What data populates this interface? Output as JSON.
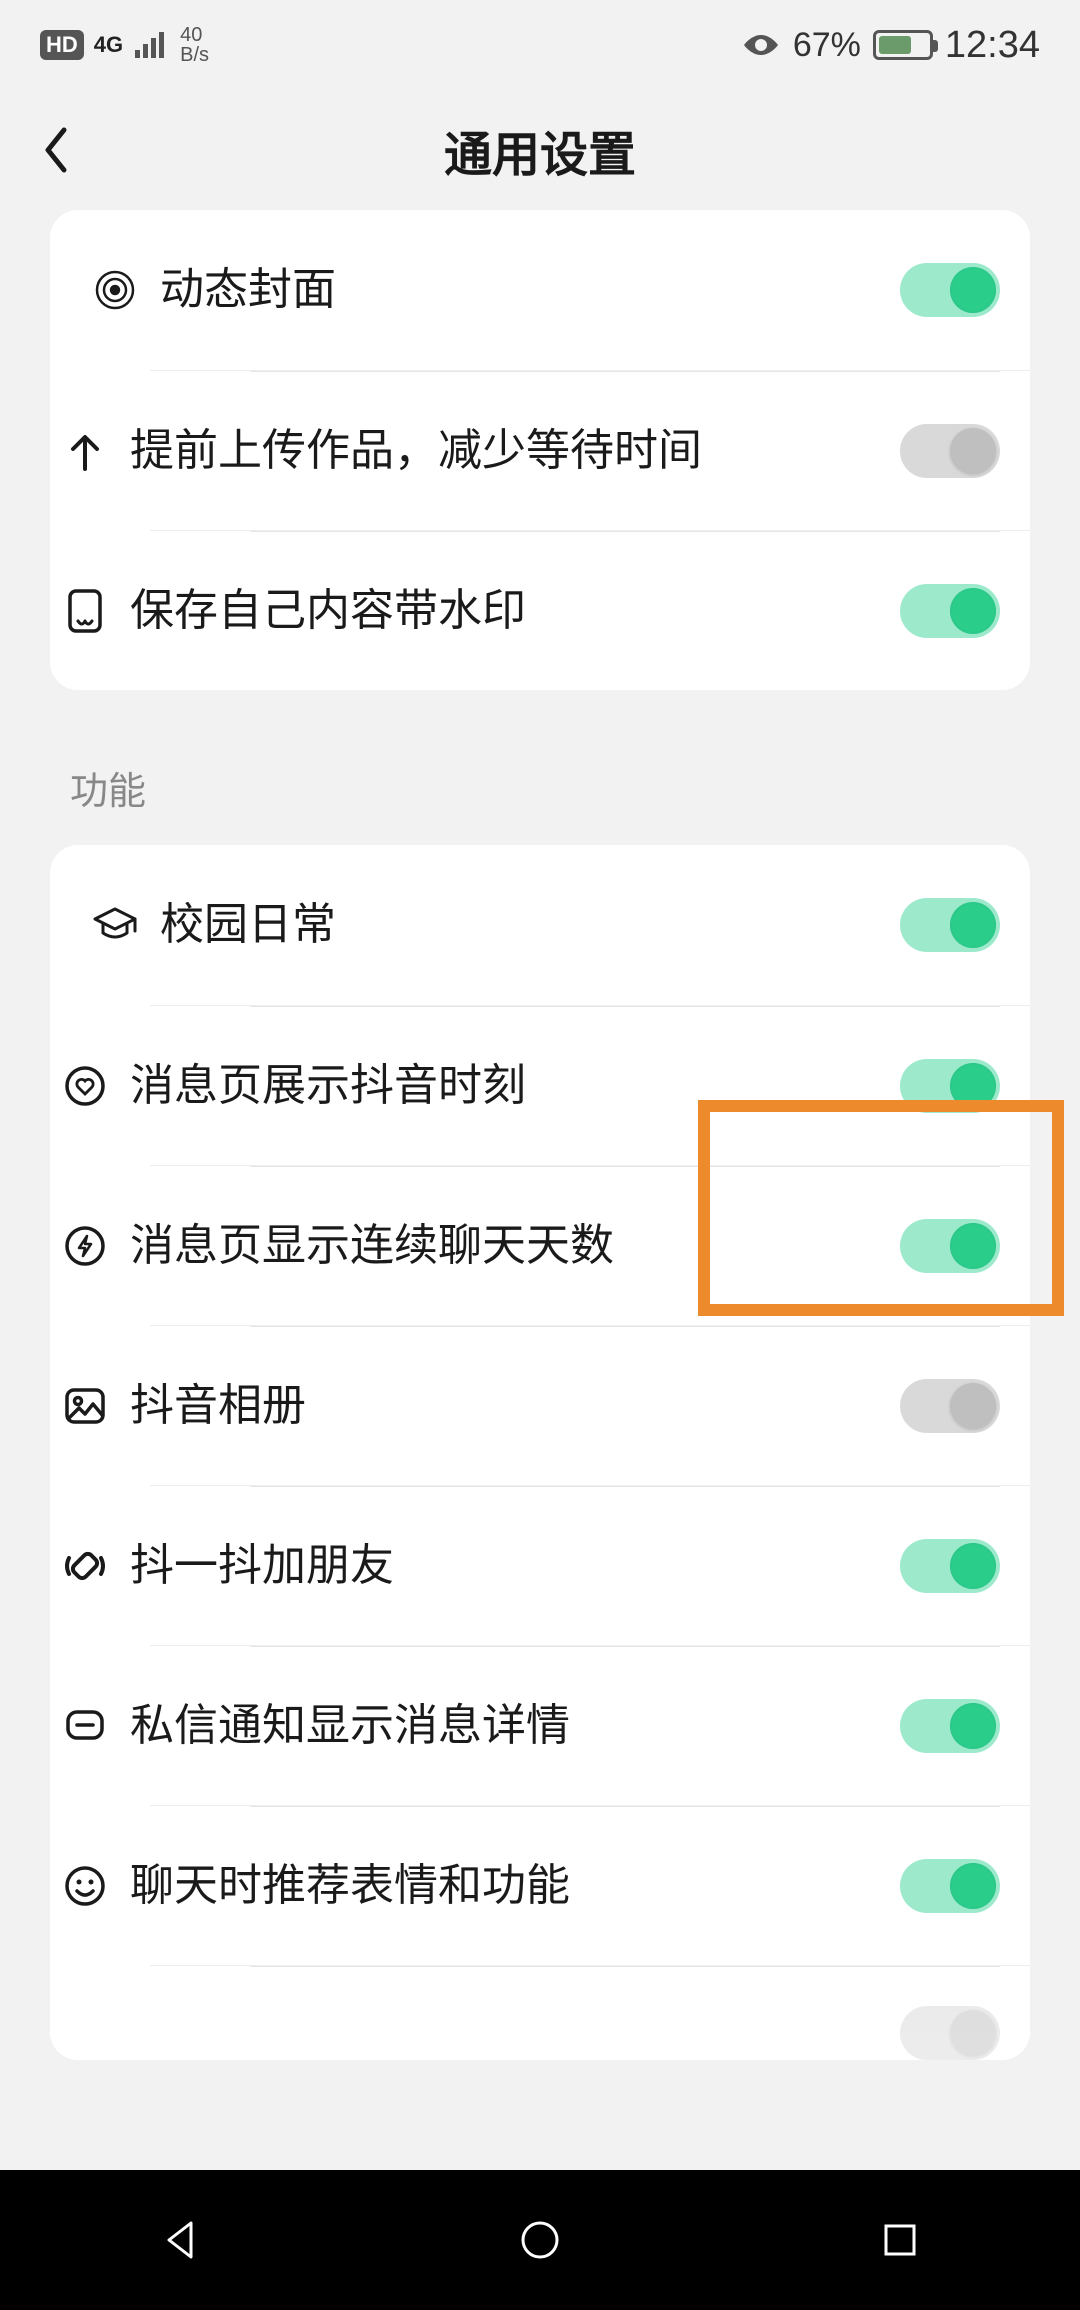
{
  "status": {
    "hd": "HD",
    "net": "4G",
    "speed_top": "40",
    "speed_bottom": "B/s",
    "battery_percent": "67%",
    "time": "12:34"
  },
  "header": {
    "title": "通用设置"
  },
  "group1": {
    "items": [
      {
        "label": "动态封面",
        "on": true,
        "icon": "target"
      },
      {
        "label": "提前上传作品，减少等待时间",
        "on": false,
        "icon": "upload"
      },
      {
        "label": "保存自己内容带水印",
        "on": true,
        "icon": "watermark"
      }
    ]
  },
  "section_label": "功能",
  "group2": {
    "items": [
      {
        "label": "校园日常",
        "on": true,
        "icon": "gradcap"
      },
      {
        "label": "消息页展示抖音时刻",
        "on": true,
        "icon": "heartcircle",
        "highlight": true
      },
      {
        "label": "消息页显示连续聊天天数",
        "on": true,
        "icon": "bolt"
      },
      {
        "label": "抖音相册",
        "on": false,
        "icon": "photo"
      },
      {
        "label": "抖一抖加朋友",
        "on": true,
        "icon": "shake"
      },
      {
        "label": "私信通知显示消息详情",
        "on": true,
        "icon": "chat"
      },
      {
        "label": "聊天时推荐表情和功能",
        "on": true,
        "icon": "face"
      }
    ]
  }
}
